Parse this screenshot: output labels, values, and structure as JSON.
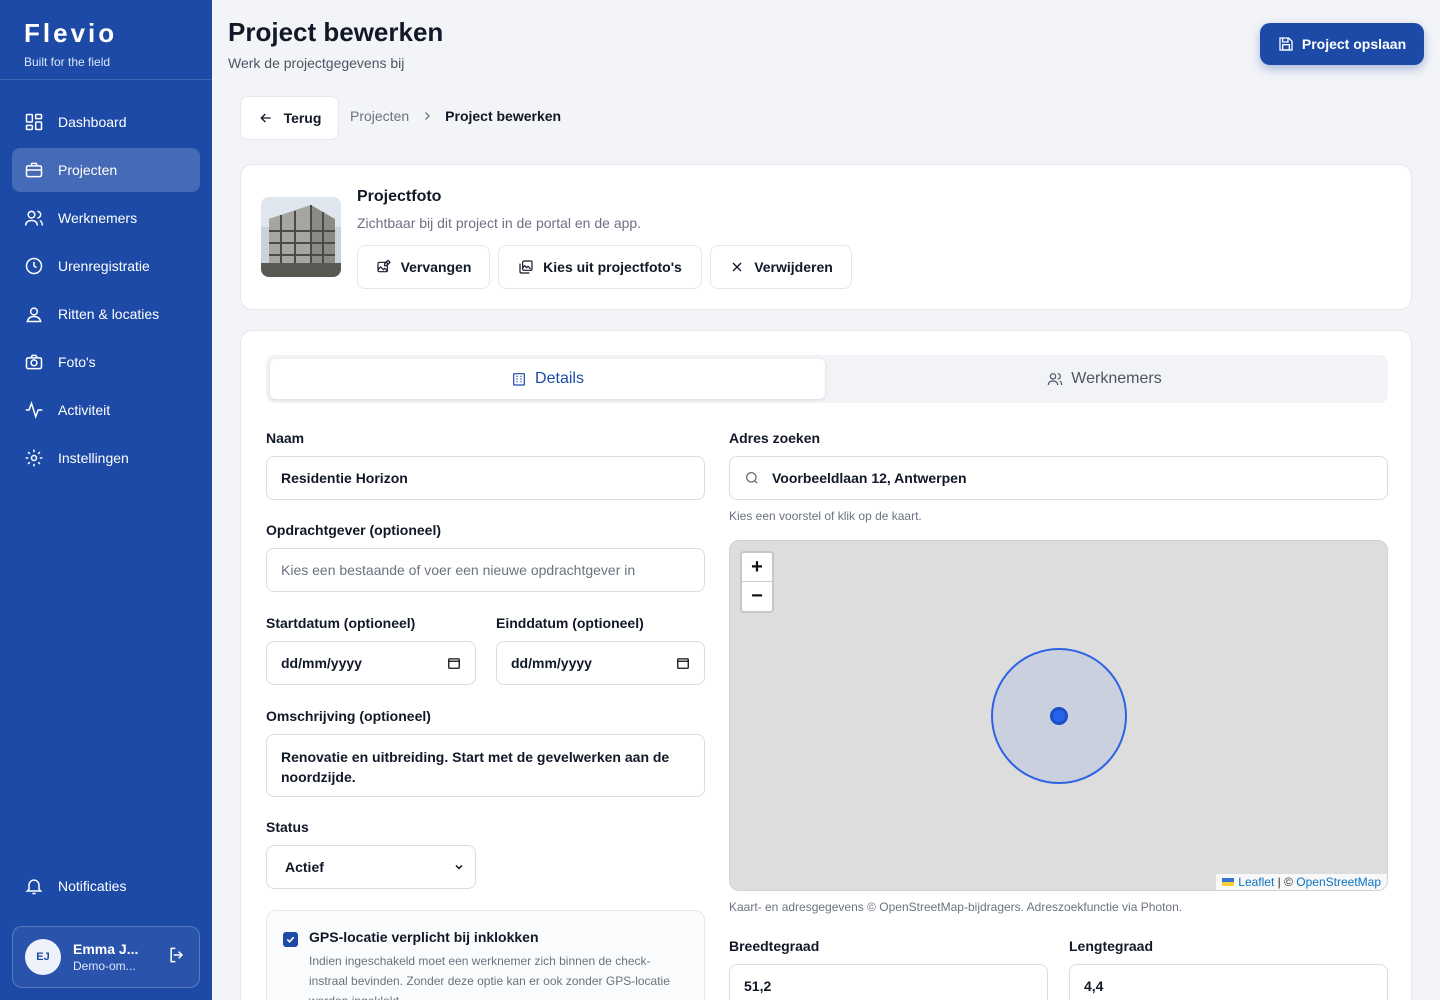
{
  "brand": {
    "name": "Flevio",
    "tagline": "Built for the field"
  },
  "sidebar": {
    "items": [
      {
        "label": "Dashboard",
        "icon": "dashboard-icon"
      },
      {
        "label": "Projecten",
        "icon": "briefcase-icon",
        "active": true
      },
      {
        "label": "Werknemers",
        "icon": "users-icon"
      },
      {
        "label": "Urenregistratie",
        "icon": "clock-icon"
      },
      {
        "label": "Ritten & locaties",
        "icon": "map-pin-icon"
      },
      {
        "label": "Foto's",
        "icon": "camera-icon"
      },
      {
        "label": "Activiteit",
        "icon": "activity-icon"
      },
      {
        "label": "Instellingen",
        "icon": "gear-icon"
      }
    ],
    "notifications": {
      "label": "Notificaties",
      "icon": "bell-icon"
    },
    "user": {
      "initials": "EJ",
      "name": "Emma J...",
      "org": "Demo-om..."
    }
  },
  "header": {
    "title": "Project bewerken",
    "subtitle": "Werk de projectgegevens bij",
    "save_label": "Project opslaan"
  },
  "nav": {
    "back_label": "Terug",
    "breadcrumb": [
      "Projecten",
      "Project bewerken"
    ]
  },
  "photo": {
    "title": "Projectfoto",
    "subtitle": "Zichtbaar bij dit project in de portal en de app.",
    "replace_label": "Vervangen",
    "choose_label": "Kies uit projectfoto's",
    "remove_label": "Verwijderen"
  },
  "tabs": [
    {
      "label": "Details",
      "icon": "building-icon",
      "active": true
    },
    {
      "label": "Werknemers",
      "icon": "users-icon",
      "active": false
    }
  ],
  "form": {
    "name": {
      "label": "Naam",
      "value": "Residentie Horizon"
    },
    "client": {
      "label": "Opdrachtgever (optioneel)",
      "placeholder": "Kies een bestaande of voer een nieuwe opdrachtgever in"
    },
    "start": {
      "label": "Startdatum (optioneel)",
      "value": "dd/mm/yyyy"
    },
    "end": {
      "label": "Einddatum (optioneel)",
      "value": "dd/mm/yyyy"
    },
    "description": {
      "label": "Omschrijving (optioneel)",
      "value": "Renovatie en uitbreiding. Start met de gevelwerken aan de noordzijde."
    },
    "status": {
      "label": "Status",
      "value": "Actief"
    },
    "gps": {
      "checked": true,
      "title": "GPS-locatie verplicht bij inklokken",
      "description": "Indien ingeschakeld moet een werknemer zich binnen de check-instraal bevinden. Zonder deze optie kan er ook zonder GPS-locatie worden ingeklokt."
    },
    "address": {
      "label": "Adres zoeken",
      "value": "Voorbeeldlaan 12, Antwerpen",
      "hint": "Kies een voorstel of klik op de kaart."
    },
    "map": {
      "zoom_in": "+",
      "zoom_out": "−",
      "attrib_leaflet": "Leaflet",
      "attrib_sep": " | © ",
      "attrib_osm": "OpenStreetMap",
      "credit": "Kaart- en adresgegevens © OpenStreetMap-bijdragers. Adreszoekfunctie via Photon."
    },
    "lat": {
      "label": "Breedtegraad",
      "value": "51,2"
    },
    "lng": {
      "label": "Lengtegraad",
      "value": "4,4"
    }
  },
  "colors": {
    "primary": "#1d4aa6",
    "accent": "#2563eb"
  }
}
